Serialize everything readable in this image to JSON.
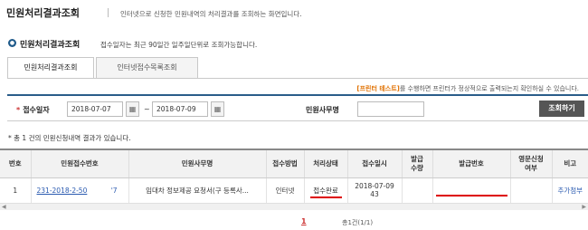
{
  "header": {
    "title": "민원처리결과조회",
    "description": "인터넷으로 신청한 민원내역의 처리결과를 조회하는 화면입니다."
  },
  "section": {
    "title": "민원처리결과조회",
    "description": "접수일자는 최근 90일간 일주일단위로 조회가능합니다."
  },
  "tabs": [
    {
      "label": "민원처리결과조회",
      "active": true
    },
    {
      "label": "인터넷접수목록조회",
      "active": false
    }
  ],
  "notice": {
    "highlight": "[프린터 테스트]",
    "text": "를 수행하면 프린터가 정상적으로 출력되는지 확인하실 수 있습니다."
  },
  "search": {
    "date_label": "접수일자",
    "required_mark": "*",
    "date_from": "2018-07-07",
    "date_to": "2018-07-09",
    "tilde": "~",
    "name_label": "민원사무명",
    "name_value": "",
    "search_button": "조회하기"
  },
  "result_count_text": "* 총 1 건의 민원신청내역 결과가 있습니다.",
  "table": {
    "headers": [
      "번호",
      "민원접수번호",
      "민원사무명",
      "접수방법",
      "처리상태",
      "접수일시",
      "발급\n수량",
      "발급번호",
      "영문신청\n여부",
      "비고"
    ],
    "rows": [
      {
        "no": "1",
        "receipt_no": "231-2018-2-50",
        "receipt_suffix": "'7",
        "name": "임대차 정보제공 요청서(구 등록사...",
        "method": "인터넷",
        "status": "접수완료",
        "date_line1": "2018-07-09",
        "date_line2": "43",
        "issue_qty": "",
        "issue_no": "",
        "english": "",
        "note": "추가첨부"
      }
    ]
  },
  "pagination": {
    "current": "1",
    "info": "총1건(1/1)"
  },
  "colors": {
    "accent": "#2a5d8a",
    "link": "#2a5ab0",
    "highlight": "#e07000",
    "redline": "#dd0000"
  }
}
